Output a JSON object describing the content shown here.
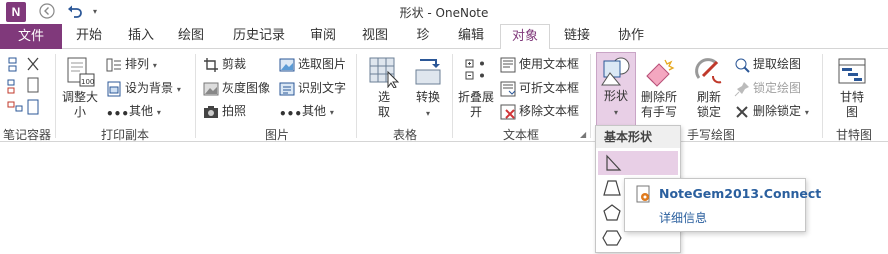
{
  "window": {
    "title": "形状 - OneNote"
  },
  "quick_access": {
    "app_icon": "N",
    "back_icon": "back-arrow-icon",
    "undo_icon": "undo-icon"
  },
  "tabs": {
    "file": "文件",
    "items": [
      "开始",
      "插入",
      "绘图",
      "历史记录",
      "审阅",
      "视图",
      "珍",
      "编辑",
      "对象",
      "链接",
      "协作"
    ],
    "active": "对象"
  },
  "groups": {
    "notebook_container": {
      "label": "笔记容器"
    },
    "printout": {
      "label": "打印副本",
      "resize": "调整大小",
      "arrange": "排列",
      "set_background": "设为背景",
      "other": "其他"
    },
    "picture": {
      "label": "图片",
      "crop": "剪裁",
      "grayscale": "灰度图像",
      "photo": "拍照",
      "select_picture": "选取图片",
      "recognize_text": "识别文字",
      "other": "其他"
    },
    "table": {
      "label": "表格",
      "select": "选取"
    },
    "textbox": {
      "label": "文本框",
      "convert": "转换",
      "fold_expand": "折叠展开",
      "use_textbox": "使用文本框",
      "foldable_textbox": "可折文本框",
      "remove_textbox": "移除文本框"
    },
    "ink": {
      "label": "手写绘图",
      "shapes": "形状",
      "delete_all": "删除所有手写",
      "refresh_lock": "刷新锁定",
      "extract_drawing": "提取绘图",
      "lock_drawing": "锁定绘图",
      "delete_lock": "删除锁定"
    },
    "gantt": {
      "label": "甘特图",
      "gantt_button": "甘特图"
    }
  },
  "shape_menu": {
    "header": "基本形状",
    "shapes": [
      "right-triangle-icon",
      "trapezoid-icon",
      "pentagon-icon",
      "hexagon-icon"
    ]
  },
  "addin_popup": {
    "name": "NoteGem2013.Connect",
    "link": "详细信息"
  },
  "colors": {
    "accent": "#80397b",
    "link": "#2a5f9e",
    "selected": "#e8cfe6"
  }
}
